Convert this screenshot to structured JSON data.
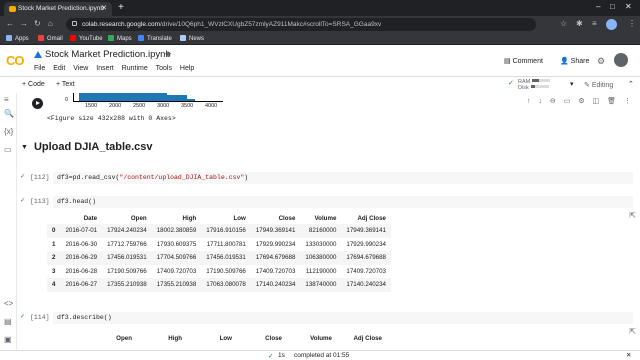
{
  "browser": {
    "tab_title": "Stock Market Prediction.ipynb",
    "url_host": "colab.research.google.com",
    "url_path": "/drive/10Q6ph1_WVzlCXUgbZ57zmlyAZ911Makc#scrollTo=SRSA_GGaa9xv",
    "bookmarks": [
      "Apps",
      "Gmail",
      "YouTube",
      "Maps",
      "Translate",
      "News"
    ]
  },
  "colab": {
    "logo": "CO",
    "notebook_title": "Stock Market Prediction.ipynb",
    "menu": [
      "File",
      "Edit",
      "View",
      "Insert",
      "Runtime",
      "Tools",
      "Help"
    ],
    "comment_label": "Comment",
    "share_label": "Share",
    "add_code": "+ Code",
    "add_text": "+ Text",
    "ram_label": "RAM",
    "disk_label": "Disk",
    "ram_usage": 0.35,
    "disk_usage": 0.25,
    "editing_label": "Editing"
  },
  "prev_output": {
    "x_ticks": [
      "1500",
      "2000",
      "2500",
      "3000",
      "3500",
      "4000"
    ],
    "y_tick": "0",
    "figure_text": "<Figure size 432x288 with 0 Axes>"
  },
  "section_title": "Upload DJIA_table.csv",
  "cells": {
    "c112_prompt": "[112]",
    "c112_code_prefix": "df3=pd.read_csv(",
    "c112_code_string": "\"/content/upload_DJIA_table.csv\"",
    "c112_code_suffix": ")",
    "c113_prompt": "[113]",
    "c113_code": "df3.head()",
    "c114_prompt": "[114]",
    "c114_code": "df3.describe()"
  },
  "head_table": {
    "columns": [
      "",
      "Date",
      "Open",
      "High",
      "Low",
      "Close",
      "Volume",
      "Adj Close"
    ],
    "rows": [
      [
        "0",
        "2016-07-01",
        "17924.240234",
        "18002.380859",
        "17916.910156",
        "17949.369141",
        "82160000",
        "17949.369141"
      ],
      [
        "1",
        "2016-06-30",
        "17712.759766",
        "17930.609375",
        "17711.800781",
        "17929.990234",
        "133030000",
        "17929.990234"
      ],
      [
        "2",
        "2016-06-29",
        "17456.019531",
        "17704.509766",
        "17456.019531",
        "17694.679688",
        "106380000",
        "17694.679688"
      ],
      [
        "3",
        "2016-06-28",
        "17190.509766",
        "17409.720703",
        "17190.509766",
        "17409.720703",
        "112190000",
        "17409.720703"
      ],
      [
        "4",
        "2016-06-27",
        "17355.210938",
        "17355.210938",
        "17063.080078",
        "17140.240234",
        "138740000",
        "17140.240234"
      ]
    ]
  },
  "describe_columns": [
    "Open",
    "High",
    "Low",
    "Close",
    "Volume",
    "Adj Close"
  ],
  "status": {
    "check": "✓",
    "duration": "1s",
    "completed": "completed at 01:55"
  }
}
